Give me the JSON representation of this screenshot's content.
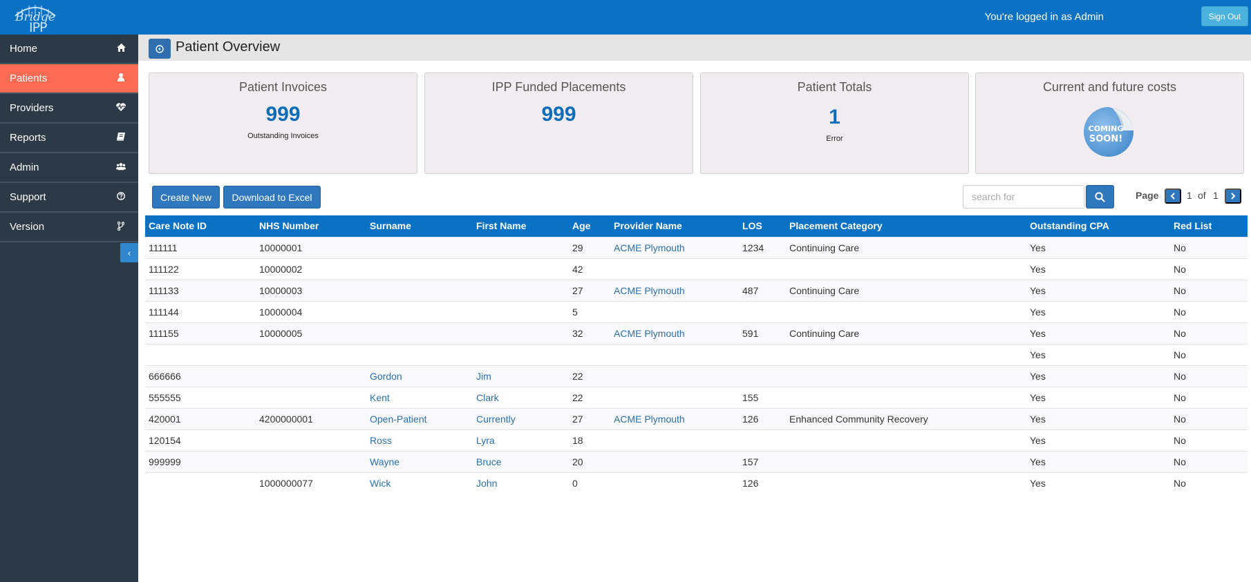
{
  "app": {
    "logo_top": "Bridge",
    "logo_bottom": "IPP",
    "logged_in_text": "You're logged in as Admin",
    "sign_out_label": "Sign Out"
  },
  "sidebar": {
    "items": [
      {
        "label": "Home",
        "icon": "home-icon",
        "active": false
      },
      {
        "label": "Patients",
        "icon": "user-icon",
        "active": true
      },
      {
        "label": "Providers",
        "icon": "heartbeat-icon",
        "active": false
      },
      {
        "label": "Reports",
        "icon": "book-icon",
        "active": false
      },
      {
        "label": "Admin",
        "icon": "users-icon",
        "active": false
      },
      {
        "label": "Support",
        "icon": "question-circle-icon",
        "active": false
      },
      {
        "label": "Version",
        "icon": "code-branch-icon",
        "active": false
      }
    ],
    "collapse_glyph": "‹"
  },
  "header": {
    "title": "Patient Overview"
  },
  "cards": [
    {
      "title": "Patient Invoices",
      "value": "999",
      "subtitle": "Outstanding Invoices"
    },
    {
      "title": "IPP Funded Placements",
      "value": "999",
      "subtitle": ""
    },
    {
      "title": "Patient Totals",
      "value": "1",
      "subtitle": "Error"
    },
    {
      "title": "Current and future costs",
      "badge_line1": "COMING",
      "badge_line2": "SOON!"
    }
  ],
  "toolbar": {
    "create_new_label": "Create New",
    "download_label": "Download to Excel",
    "search_placeholder": "search for",
    "page_label": "Page",
    "current_page": "1",
    "of_label": "of",
    "total_pages": "1"
  },
  "table": {
    "columns": [
      "Care Note ID",
      "NHS Number",
      "Surname",
      "First Name",
      "Age",
      "Provider Name",
      "LOS",
      "Placement Category",
      "Outstanding CPA",
      "Red List"
    ],
    "rows": [
      [
        "111111",
        "10000001",
        "",
        "",
        "29",
        "ACME Plymouth",
        "1234",
        "Continuing Care",
        "Yes",
        "No"
      ],
      [
        "111122",
        "10000002",
        "",
        "",
        "42",
        "",
        "",
        "",
        "Yes",
        "No"
      ],
      [
        "111133",
        "10000003",
        "",
        "",
        "27",
        "ACME Plymouth",
        "487",
        "Continuing Care",
        "Yes",
        "No"
      ],
      [
        "111144",
        "10000004",
        "",
        "",
        "5",
        "",
        "",
        "",
        "Yes",
        "No"
      ],
      [
        "111155",
        "10000005",
        "",
        "",
        "32",
        "ACME Plymouth",
        "591",
        "Continuing Care",
        "Yes",
        "No"
      ],
      [
        "",
        "",
        "",
        "",
        "",
        "",
        "",
        "",
        "Yes",
        "No"
      ],
      [
        "666666",
        "",
        "Gordon",
        "Jim",
        "22",
        "",
        "",
        "",
        "Yes",
        "No"
      ],
      [
        "555555",
        "",
        "Kent",
        "Clark",
        "22",
        "",
        "155",
        "",
        "Yes",
        "No"
      ],
      [
        "420001",
        "4200000001",
        "Open-Patient",
        "Currently",
        "27",
        "ACME Plymouth",
        "126",
        "Enhanced Community Recovery",
        "Yes",
        "No"
      ],
      [
        "120154",
        "",
        "Ross",
        "Lyra",
        "18",
        "",
        "",
        "",
        "Yes",
        "No"
      ],
      [
        "999999",
        "",
        "Wayne",
        "Bruce",
        "20",
        "",
        "157",
        "",
        "Yes",
        "No"
      ],
      [
        "",
        "1000000077",
        "Wick",
        "John",
        "0",
        "",
        "126",
        "",
        "Yes",
        "No"
      ]
    ]
  },
  "colors": {
    "topbar": "#0a72c4",
    "sidebar": "#2b3a46",
    "active_nav": "#fb6a52",
    "accent_blue": "#2f78bd",
    "link": "#2a70ab"
  }
}
